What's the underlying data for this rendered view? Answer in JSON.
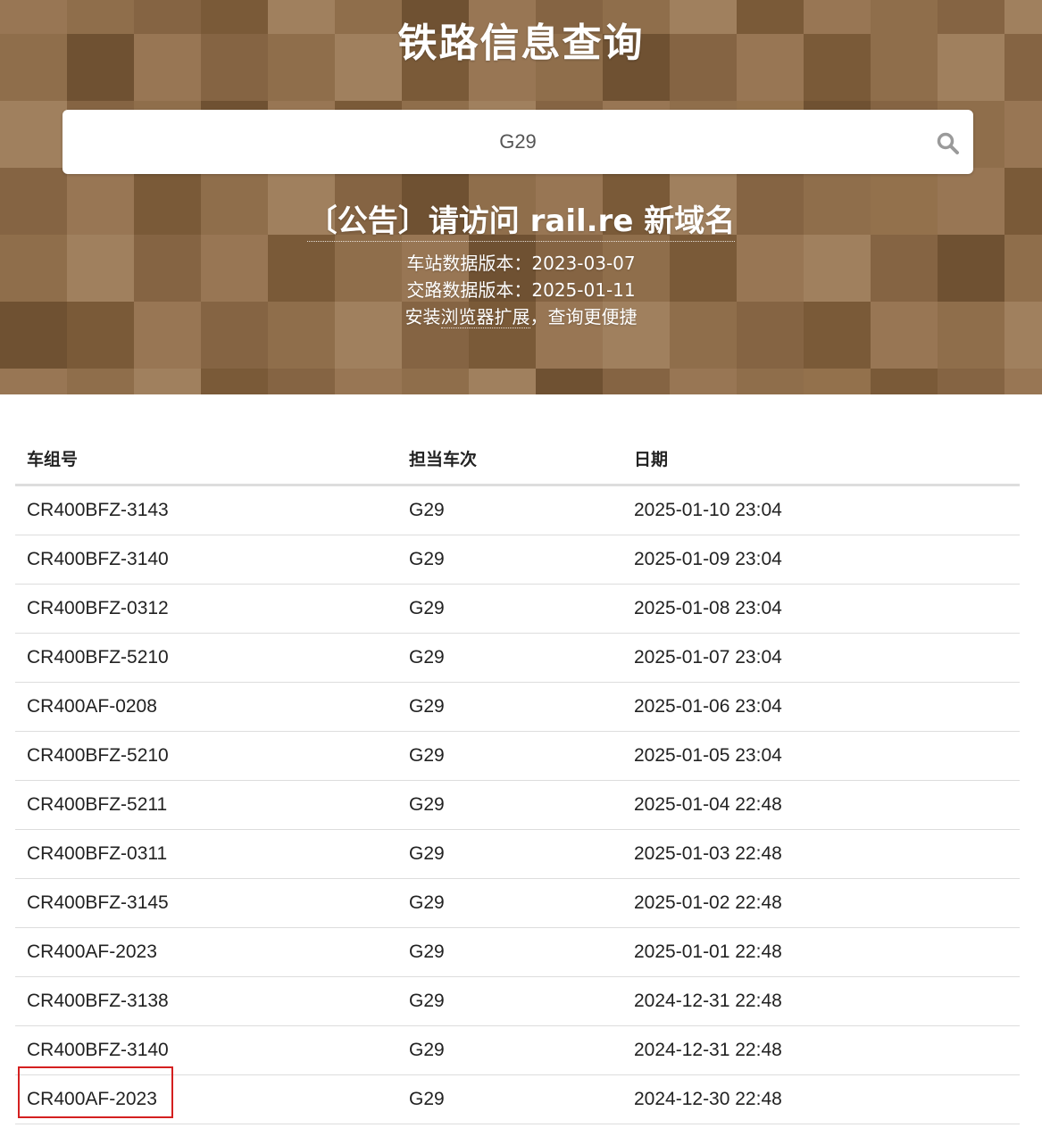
{
  "header": {
    "title": "铁路信息查询",
    "notice": "〔公告〕请访问 rail.re 新域名",
    "station_version_label": "车站数据版本：",
    "station_version": "2023-03-07",
    "route_version_label": "交路数据版本：",
    "route_version": "2025-01-11",
    "ext_prefix": "安装",
    "ext_link": "浏览器扩展",
    "ext_suffix": "，查询更便捷"
  },
  "search": {
    "value": "G29",
    "icon": "search-icon"
  },
  "table": {
    "headers": [
      "车组号",
      "担当车次",
      "日期"
    ],
    "rows": [
      [
        "CR400BFZ-3143",
        "G29",
        "2025-01-10 23:04"
      ],
      [
        "CR400BFZ-3140",
        "G29",
        "2025-01-09 23:04"
      ],
      [
        "CR400BFZ-0312",
        "G29",
        "2025-01-08 23:04"
      ],
      [
        "CR400BFZ-5210",
        "G29",
        "2025-01-07 23:04"
      ],
      [
        "CR400AF-0208",
        "G29",
        "2025-01-06 23:04"
      ],
      [
        "CR400BFZ-5210",
        "G29",
        "2025-01-05 23:04"
      ],
      [
        "CR400BFZ-5211",
        "G29",
        "2025-01-04 22:48"
      ],
      [
        "CR400BFZ-0311",
        "G29",
        "2025-01-03 22:48"
      ],
      [
        "CR400BFZ-3145",
        "G29",
        "2025-01-02 22:48"
      ],
      [
        "CR400AF-2023",
        "G29",
        "2025-01-01 22:48"
      ],
      [
        "CR400BFZ-3138",
        "G29",
        "2024-12-31 22:48"
      ],
      [
        "CR400BFZ-3140",
        "G29",
        "2024-12-31 22:48"
      ],
      [
        "CR400AF-2023",
        "G29",
        "2024-12-30 22:48"
      ]
    ]
  },
  "colors": {
    "hero_base": "#8a6a45",
    "tile_palette": [
      "#7a5a38",
      "#856443",
      "#8f6e4b",
      "#987654",
      "#a0805e",
      "#6f5132",
      "#93714c"
    ],
    "highlight": "#d42020"
  }
}
